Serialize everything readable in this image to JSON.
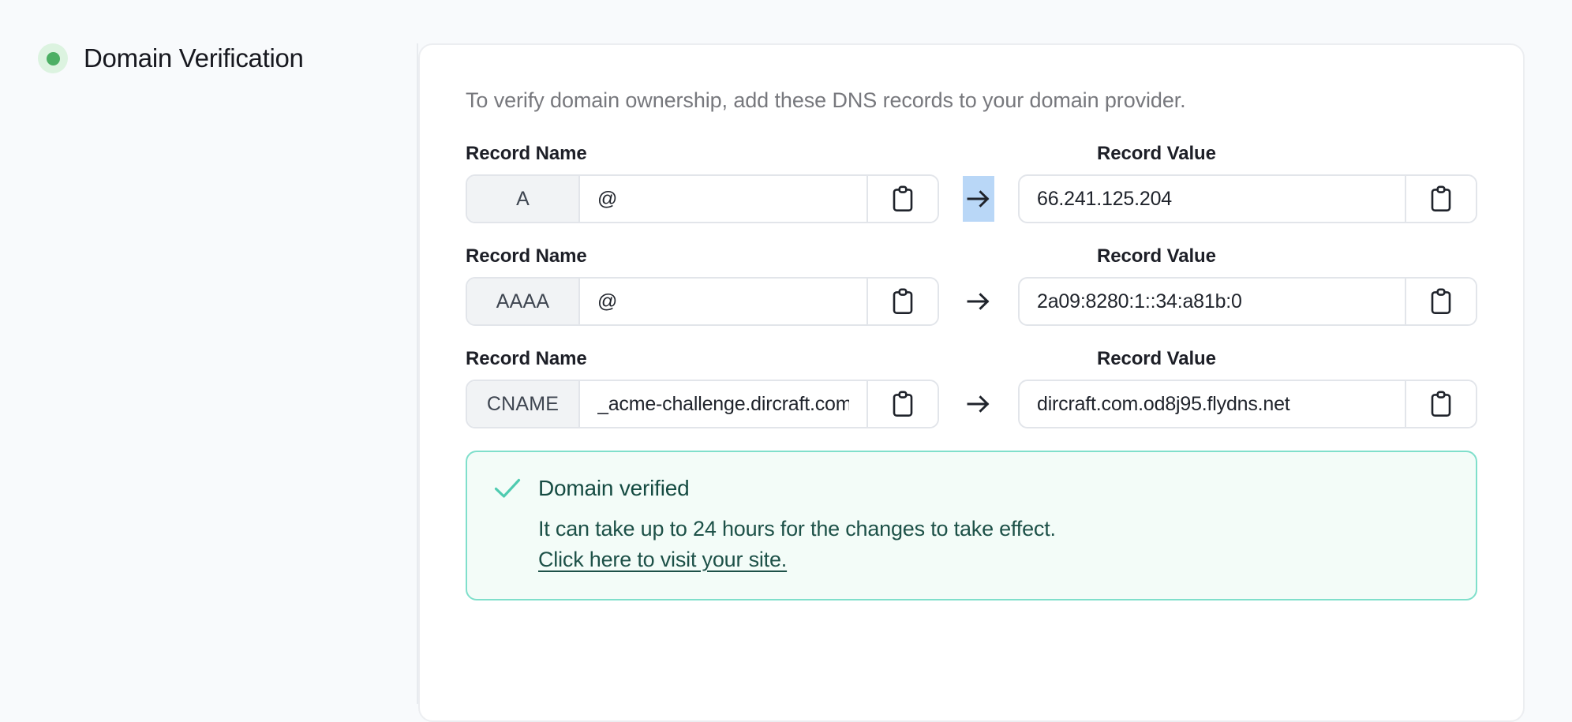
{
  "section": {
    "title": "Domain Verification",
    "status_icon": "status-dot-verified",
    "status_color": "#4caf64",
    "status_ring_color": "#dcf3e0"
  },
  "card": {
    "intro": "To verify domain ownership, add these DNS records to your domain provider.",
    "column_headers": {
      "name": "Record Name",
      "value": "Record Value"
    },
    "arrow_icon": "arrow-right-icon",
    "copy_icon": "clipboard-icon",
    "selection_highlight_color": "#b9d7f7",
    "records": [
      {
        "type": "A",
        "name": "@",
        "value": "66.241.125.204",
        "name_label": "Record Name",
        "value_label": "Record Value",
        "arrow_selected": true
      },
      {
        "type": "AAAA",
        "name": "@",
        "value": "2a09:8280:1::34:a81b:0",
        "name_label": "Record Name",
        "value_label": "Record Value",
        "arrow_selected": false
      },
      {
        "type": "CNAME",
        "name": "_acme-challenge.dircraft.com",
        "value": "dircraft.com.od8j95.flydns.net",
        "name_label": "Record Name",
        "value_label": "Record Value",
        "arrow_selected": false
      }
    ],
    "banner": {
      "icon": "check-icon",
      "title": "Domain verified",
      "message": "It can take up to 24 hours for the changes to take effect.",
      "link_text": "Click here to visit your site.",
      "border_color": "#7fdfcb",
      "background_color": "#f3fcf8",
      "accent_color": "#4ecbb0"
    }
  }
}
